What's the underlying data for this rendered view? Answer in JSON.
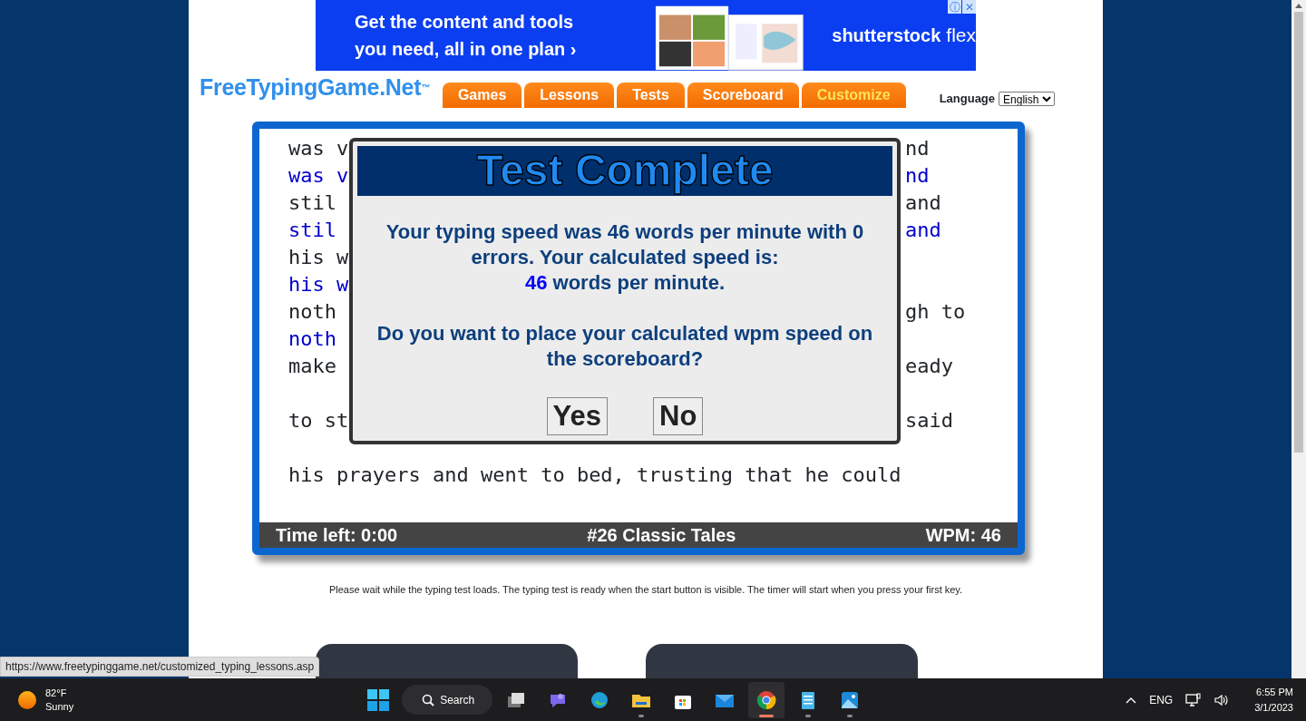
{
  "ad": {
    "headline": "Get the content and tools you need, all in one plan",
    "arrow": "›",
    "brand": "shutterstock",
    "brand_suffix": "flex",
    "info": "ⓘ",
    "close": "✕"
  },
  "logo": "FreeTypingGame.Net$^{™}$",
  "nav_tabs": [
    {
      "label": "Games",
      "selected": false
    },
    {
      "label": "Lessons",
      "selected": false
    },
    {
      "label": "Tests",
      "selected": false
    },
    {
      "label": "Scoreboard",
      "selected": false
    },
    {
      "label": "Customize",
      "selected": true
    }
  ],
  "language": {
    "label": "Language",
    "value": "English"
  },
  "typing_lines": [
    {
      "kind": "source",
      "left": "was v",
      "right": "nd"
    },
    {
      "kind": "typed",
      "left": "was v",
      "right": "nd"
    },
    {
      "kind": "source",
      "left": "stil",
      "right": "and"
    },
    {
      "kind": "typed",
      "left": "stil",
      "right": "and"
    },
    {
      "kind": "source",
      "left": "his w"
    },
    {
      "kind": "typed",
      "left": "his w"
    },
    {
      "kind": "source",
      "left": "noth",
      "right": "gh to"
    },
    {
      "kind": "typed",
      "left": "noth"
    },
    {
      "kind": "source",
      "left": "make",
      "right": "eady"
    },
    {
      "kind": "blank"
    },
    {
      "kind": "source",
      "left": "to st",
      "right": "said"
    },
    {
      "kind": "blank"
    },
    {
      "kind": "source",
      "left": "his prayers and went to bed, trusting that he could"
    }
  ],
  "status_bar": {
    "time_left": "Time left: 0:00",
    "test_name": "#26 Classic Tales",
    "wpm": "WPM: 46"
  },
  "dialog": {
    "title": "Test Complete",
    "message": "Your typing speed was 46 words per minute with 0 errors. Your calculated speed is:",
    "speed": "46",
    "speed_suffix": "words per minute.",
    "question": "Do you want to place your calculated wpm speed on the scoreboard?",
    "buttons": [
      "Yes",
      "No"
    ]
  },
  "notice": "Please wait while the typing test loads. The typing test is ready when the start button is visible. The timer will start when you press your first key.",
  "link_preview": "https://www.freetypinggame.net/customized_typing_lessons.asp",
  "taskbar": {
    "temperature": "82°F",
    "condition": "Sunny",
    "search": "Search",
    "apps": [
      {
        "kind": "taskview",
        "running": false,
        "active": false
      },
      {
        "kind": "chat",
        "running": false,
        "active": false
      },
      {
        "kind": "edge",
        "running": false,
        "active": false
      },
      {
        "kind": "files",
        "running": true,
        "active": false
      },
      {
        "kind": "store",
        "running": false,
        "active": false
      },
      {
        "kind": "mail",
        "running": false,
        "active": false
      },
      {
        "kind": "chrome",
        "running": true,
        "active": true
      },
      {
        "kind": "notepad",
        "running": true,
        "active": false
      },
      {
        "kind": "photos",
        "running": true,
        "active": false
      }
    ],
    "language": "ENG",
    "time": "6:55 PM",
    "date": "3/1/2023"
  }
}
